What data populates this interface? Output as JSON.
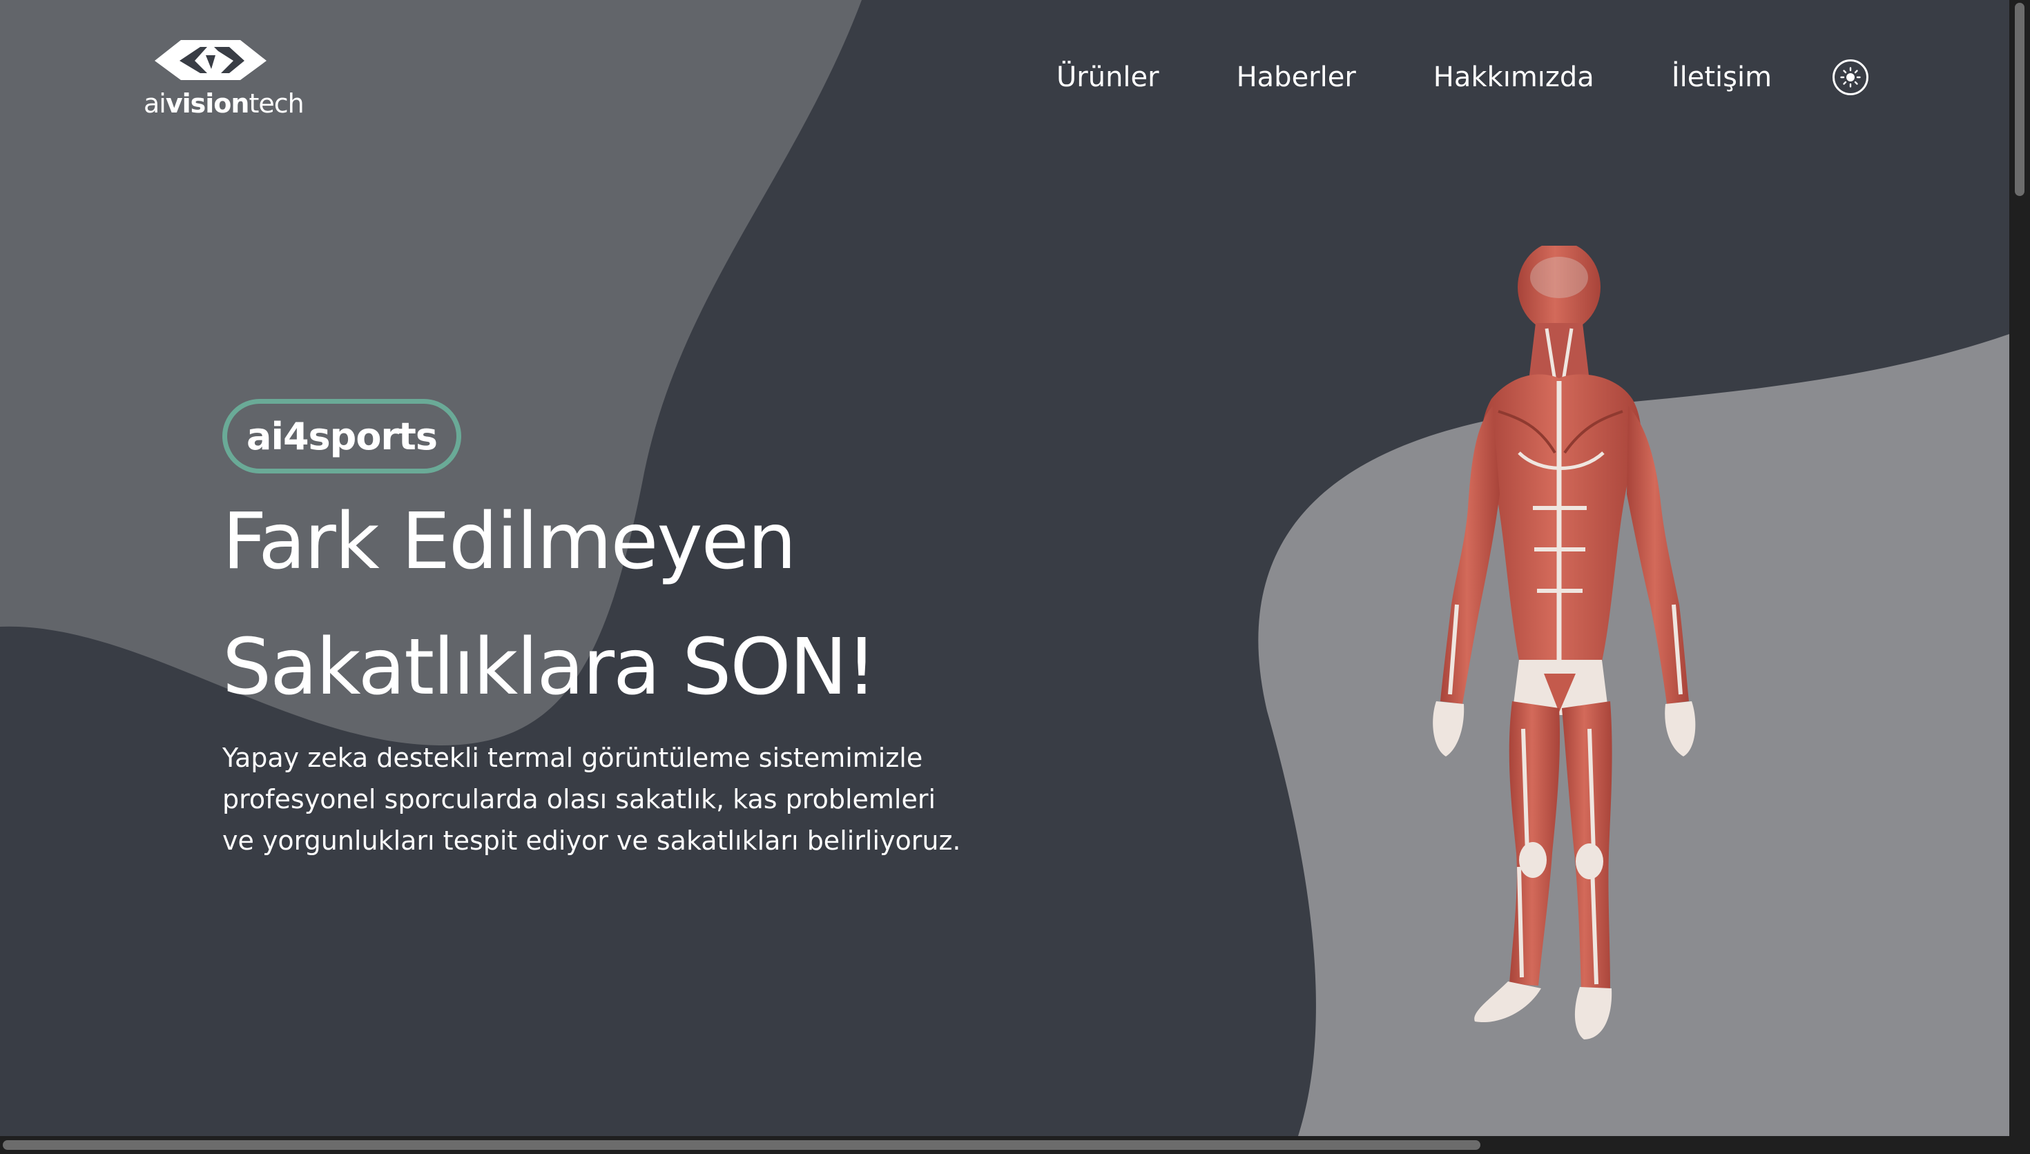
{
  "header": {
    "logo": {
      "text_light": "ai",
      "text_bold": "vision",
      "text_end": "tech"
    },
    "nav": [
      {
        "label": "Ürünler"
      },
      {
        "label": "Haberler"
      },
      {
        "label": "Hakkımızda"
      },
      {
        "label": "İletişim"
      }
    ],
    "theme_toggle_icon": "sun-icon"
  },
  "hero": {
    "badge": "ai4sports",
    "headline_line1": "Fark Edilmeyen",
    "headline_line2": "Sakatlıklara SON!",
    "description_line1": "Yapay zeka destekli termal görüntüleme sistemimizle",
    "description_line2": "profesyonel sporcularda olası sakatlık, kas problemleri",
    "description_line3": "ve yorgunlukları tespit ediyor ve sakatlıkları belirliyoruz.",
    "figure_icon": "human-muscle-anatomy-figure"
  },
  "colors": {
    "page_background": "#393d45",
    "left_blob": "#62656a",
    "right_blob": "#8b8c90",
    "badge_border": "#6aaa97",
    "text": "#ffffff",
    "muscle": "#c45a4c",
    "tendon": "#eee5df"
  }
}
